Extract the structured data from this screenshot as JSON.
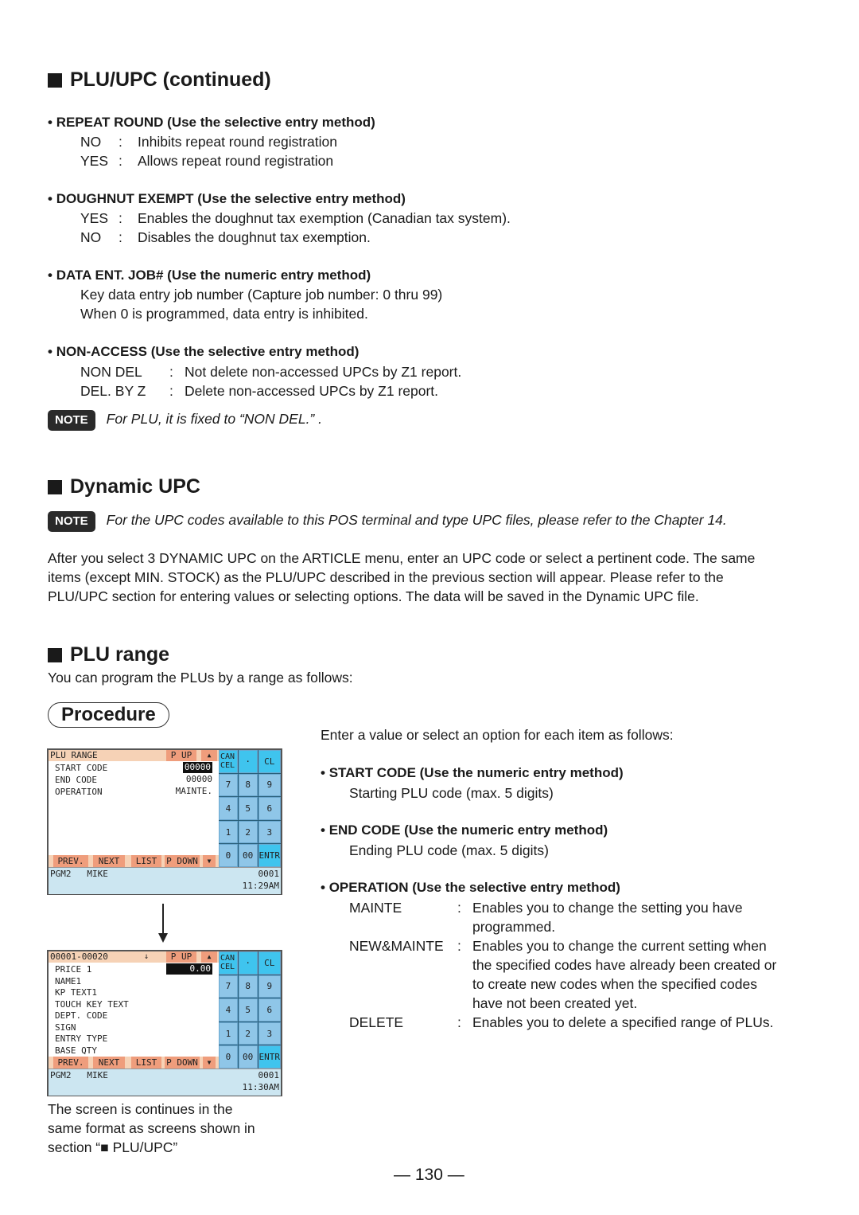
{
  "sections": {
    "plu_upc": {
      "title": "PLU/UPC (continued)",
      "repeat_round": {
        "heading": "REPEAT ROUND (Use the selective entry method)",
        "options": [
          {
            "key": "NO",
            "desc": "Inhibits repeat round registration"
          },
          {
            "key": "YES",
            "desc": "Allows repeat round registration"
          }
        ]
      },
      "doughnut_exempt": {
        "heading": "DOUGHNUT EXEMPT (Use the selective entry method)",
        "options": [
          {
            "key": "YES",
            "desc": "Enables the doughnut tax exemption (Canadian tax system)."
          },
          {
            "key": "NO",
            "desc": "Disables the doughnut tax exemption."
          }
        ]
      },
      "data_ent_job": {
        "heading": "DATA ENT. JOB# (Use the numeric entry method)",
        "lines": [
          "Key data entry job number (Capture job number: 0 thru 99)",
          "When 0 is programmed, data entry is inhibited."
        ]
      },
      "non_access": {
        "heading": "NON-ACCESS (Use the selective entry method)",
        "options": [
          {
            "key": "NON DEL",
            "desc": "Not delete non-accessed UPCs by Z1 report."
          },
          {
            "key": "DEL. BY Z",
            "desc": "Delete non-accessed UPCs by Z1 report."
          }
        ],
        "note_label": "NOTE",
        "note": "For PLU, it is fixed to “NON DEL.” ."
      }
    },
    "dynamic_upc": {
      "title": "Dynamic UPC",
      "note_label": "NOTE",
      "note": "For the UPC codes available to this POS terminal and type UPC files, please refer to the Chapter 14.",
      "paragraph": [
        "After you select 3 DYNAMIC UPC on the ARTICLE menu, enter an UPC code or select a pertinent code. The same",
        "items (except MIN. STOCK) as the PLU/UPC described in the previous section will appear. Please refer to the",
        "PLU/UPC section for entering values or selecting options. The data will be saved in the Dynamic UPC file."
      ]
    },
    "plu_range": {
      "title": "PLU range",
      "intro": "You can program the PLUs by a range as follows:",
      "procedure_label": "Procedure",
      "enter_intro": "Enter a value or select an option for each item as follows:",
      "start_code": {
        "heading": "START CODE (Use the numeric entry method)",
        "desc": "Starting PLU code (max. 5 digits)"
      },
      "end_code": {
        "heading": "END CODE (Use the numeric entry method)",
        "desc": "Ending PLU code (max. 5 digits)"
      },
      "operation": {
        "heading": "OPERATION (Use the selective entry method)",
        "options": [
          {
            "key": "MAINTE",
            "desc": [
              "Enables you to change the setting you have",
              "programmed."
            ]
          },
          {
            "key": "NEW&MAINTE",
            "desc": [
              "Enables you to change the current setting when",
              "the specified codes have already been created or",
              "to create new codes when the specified codes",
              "have not been created yet."
            ]
          },
          {
            "key": "DELETE",
            "desc": [
              "Enables you to delete a specified range of PLUs."
            ]
          }
        ]
      },
      "caption": [
        "The screen is continues in the",
        "same format as screens shown in",
        "section “■ PLU/UPC”"
      ]
    }
  },
  "screens": [
    {
      "title": "PLU RANGE",
      "p_up": "P UP",
      "up_arrow": "▲",
      "rows": [
        {
          "label": "START CODE",
          "value": "00000",
          "highlight": true
        },
        {
          "label": "END CODE",
          "value": "00000"
        },
        {
          "label": "OPERATION",
          "value": "MAINTE."
        }
      ],
      "func_keys": [
        "PREV.",
        "NEXT",
        "LIST",
        "P DOWN",
        "▼"
      ],
      "keypad": [
        "CAN",
        "CEL",
        "·",
        "CL",
        "7",
        "8",
        "9",
        "4",
        "5",
        "6",
        "1",
        "2",
        "3",
        "0",
        "00",
        "ENTR"
      ],
      "status": {
        "mode": "PGM2",
        "clerk": "MIKE",
        "number": "0001",
        "time": "11:29AM"
      }
    },
    {
      "title": "00001-00020",
      "down_arrow": "↓",
      "p_up": "P UP",
      "up_arrow": "▲",
      "rows": [
        {
          "label": "PRICE 1",
          "value": "0.00",
          "highlight": true
        },
        {
          "label": "NAME1",
          "value": ""
        },
        {
          "label": "KP TEXT1",
          "value": ""
        },
        {
          "label": "TOUCH KEY TEXT",
          "value": ""
        },
        {
          "label": "DEPT. CODE",
          "value": ""
        },
        {
          "label": "SIGN",
          "value": ""
        },
        {
          "label": "ENTRY TYPE",
          "value": ""
        },
        {
          "label": "BASE QTY",
          "value": ""
        }
      ],
      "func_keys": [
        "PREV.",
        "NEXT",
        "LIST",
        "P DOWN",
        "▼"
      ],
      "keypad": [
        "CAN",
        "CEL",
        "·",
        "CL",
        "7",
        "8",
        "9",
        "4",
        "5",
        "6",
        "1",
        "2",
        "3",
        "0",
        "00",
        "ENTR"
      ],
      "status": {
        "mode": "PGM2",
        "clerk": "MIKE",
        "number": "0001",
        "time": "11:30AM"
      }
    }
  ],
  "page_number": "— 130 —"
}
